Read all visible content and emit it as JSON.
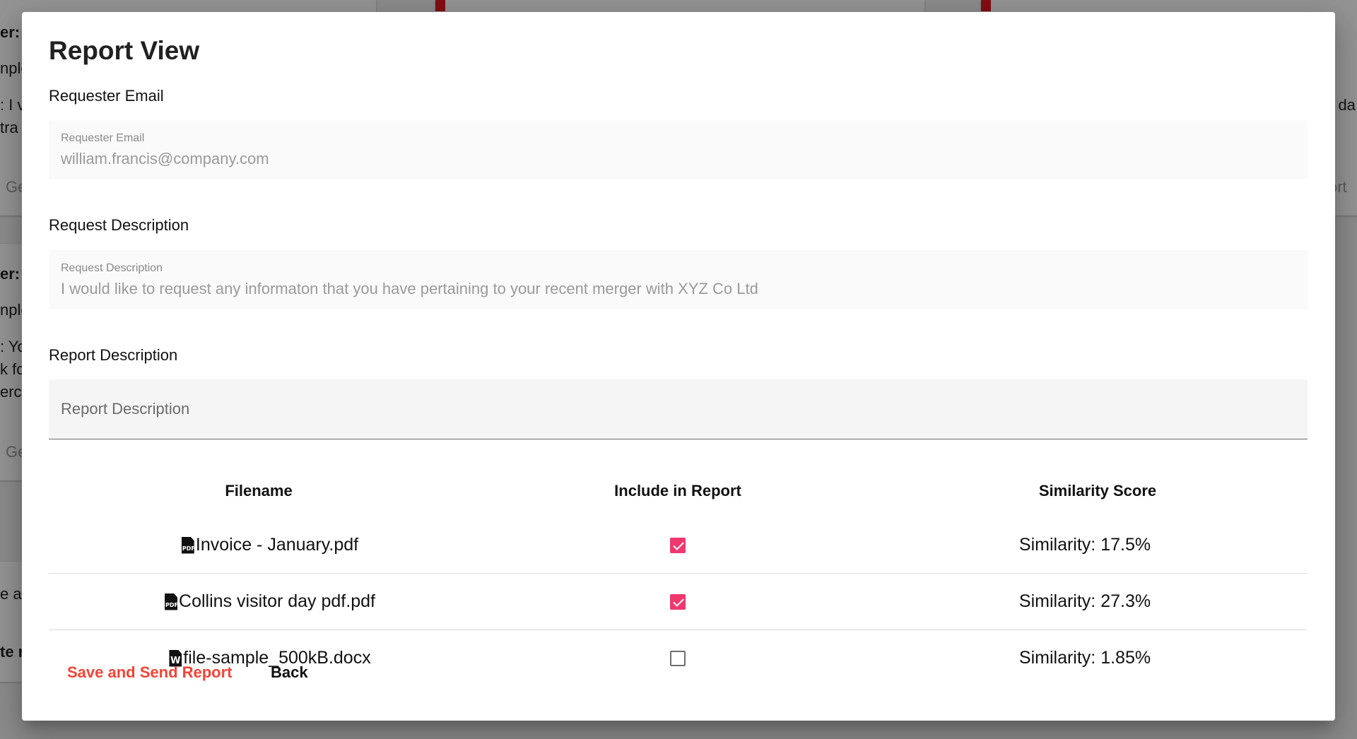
{
  "background": {
    "fragments": [
      {
        "text": "er:",
        "bold": true
      },
      {
        "text": "nple",
        "bold": false
      },
      {
        "text": ": I v",
        "bold": false
      },
      {
        "text": "tra",
        "bold": false
      },
      {
        "text": "Ge",
        "muted": true
      },
      {
        "text": "er:",
        "bold": true
      },
      {
        "text": "nple",
        "bold": false
      },
      {
        "text": ": Yo",
        "bold": false
      },
      {
        "text": "k fo",
        "bold": false
      },
      {
        "text": "erc",
        "bold": false
      },
      {
        "text": "Ge",
        "muted": true
      },
      {
        "text": "e a",
        "bold": false
      },
      {
        "text": "te r",
        "bold": true
      },
      {
        "text": "r da",
        "bold": false
      },
      {
        "text": "ort",
        "muted": true
      }
    ]
  },
  "dialog": {
    "title": "Report View",
    "requester_email": {
      "section_label": "Requester Email",
      "field_label": "Requester Email",
      "value": "william.francis@company.com"
    },
    "request_description": {
      "section_label": "Request Description",
      "field_label": "Request Description",
      "value": "I would like to request any informaton that you have pertaining to your recent merger with XYZ Co Ltd"
    },
    "report_description": {
      "section_label": "Report Description",
      "placeholder": "Report Description",
      "value": ""
    },
    "table": {
      "headers": {
        "filename": "Filename",
        "include": "Include in Report",
        "score": "Similarity Score"
      },
      "rows": [
        {
          "filename": "Invoice - January.pdf",
          "icon": "pdf-file-icon",
          "included": true,
          "score": "Similarity: 17.5%"
        },
        {
          "filename": "Collins visitor day pdf.pdf",
          "icon": "pdf-file-icon",
          "included": true,
          "score": "Similarity: 27.3%"
        },
        {
          "filename": "file-sample_500kB.docx",
          "icon": "word-file-icon",
          "included": false,
          "score": "Similarity: 1.85%"
        }
      ]
    },
    "actions": {
      "save_label": "Save and Send Report",
      "back_label": "Back"
    },
    "colors": {
      "accent_pink": "#f0386e",
      "primary_red": "#f44336"
    }
  }
}
